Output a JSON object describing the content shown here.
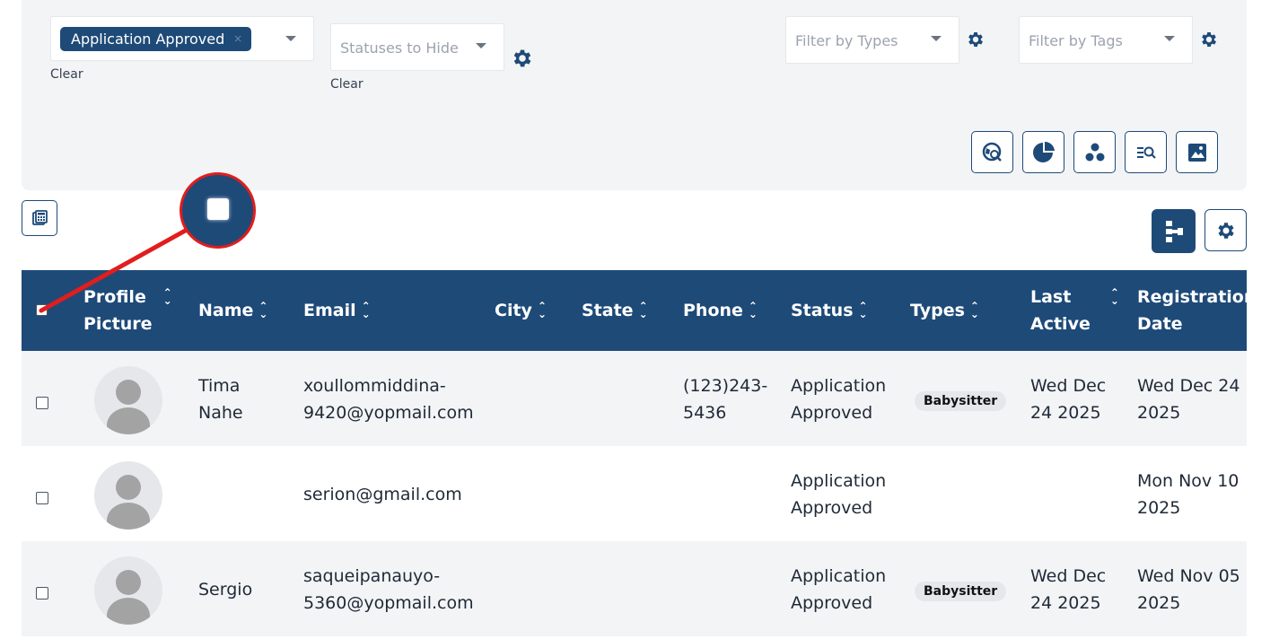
{
  "filters": {
    "status_chip": "Application Approved",
    "status_chip_remove": "×",
    "status_clear": "Clear",
    "hide_placeholder": "Statuses to Hide",
    "hide_clear": "Clear",
    "types_placeholder": "Filter by Types",
    "tags_placeholder": "Filter by Tags"
  },
  "toolbar_icons": [
    "map-search-icon",
    "pie-chart-icon",
    "cluster-icon",
    "list-search-icon",
    "image-icon"
  ],
  "table": {
    "headers": {
      "profile_line1": "Profile",
      "profile_line2": "Picture",
      "name": "Name",
      "email": "Email",
      "city": "City",
      "state": "State",
      "phone": "Phone",
      "status": "Status",
      "types": "Types",
      "last_line1": "Last",
      "last_line2": "Active",
      "reg_line1": "Registration",
      "reg_line2": "Date"
    },
    "rows": [
      {
        "name_line1": "Tima",
        "name_line2": "Nahe",
        "email_line1": "xoullommiddina-",
        "email_line2": "9420@yopmail.com",
        "phone_line1": "(123)243-",
        "phone_line2": "5436",
        "status_line1": "Application",
        "status_line2": "Approved",
        "type": "Babysitter",
        "last_line1": "Wed Dec",
        "last_line2": "24 2025",
        "reg_line1": "Wed Dec 24",
        "reg_line2": "2025"
      },
      {
        "name_line1": "",
        "name_line2": "",
        "email_line1": "serion@gmail.com",
        "email_line2": "",
        "phone_line1": "",
        "phone_line2": "",
        "status_line1": "Application",
        "status_line2": "Approved",
        "type": "",
        "last_line1": "",
        "last_line2": "",
        "reg_line1": "Mon Nov 10",
        "reg_line2": "2025"
      },
      {
        "name_line1": "Sergio",
        "name_line2": "",
        "email_line1": "saqueipanauyo-",
        "email_line2": "5360@yopmail.com",
        "phone_line1": "",
        "phone_line2": "",
        "status_line1": "Application",
        "status_line2": "Approved",
        "type": "Babysitter",
        "last_line1": "Wed Dec",
        "last_line2": "24 2025",
        "reg_line1": "Wed Nov 05",
        "reg_line2": "2025"
      }
    ]
  },
  "colors": {
    "primary": "#1e4a78",
    "annotation": "#e11d1d",
    "row_alt": "#f3f4f6"
  }
}
